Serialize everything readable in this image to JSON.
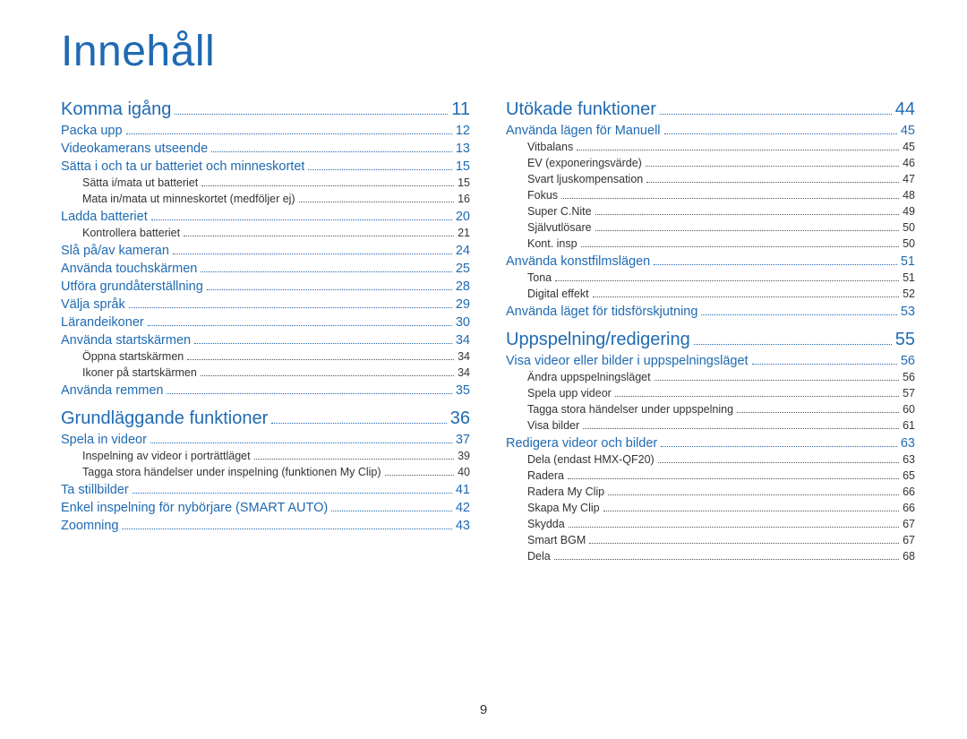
{
  "title": "Innehåll",
  "page_number": "9",
  "columns": [
    [
      {
        "level": 0,
        "label": "Komma igång",
        "page": "11"
      },
      {
        "level": 1,
        "label": "Packa upp",
        "page": "12"
      },
      {
        "level": 1,
        "label": "Videokamerans utseende",
        "page": "13"
      },
      {
        "level": 1,
        "label": "Sätta i och ta ur batteriet och minneskortet",
        "page": "15"
      },
      {
        "level": 2,
        "label": "Sätta i/mata ut batteriet",
        "page": "15"
      },
      {
        "level": 2,
        "label": "Mata in/mata ut minneskortet (medföljer ej)",
        "page": "16"
      },
      {
        "level": 1,
        "label": "Ladda batteriet",
        "page": "20"
      },
      {
        "level": 2,
        "label": "Kontrollera batteriet",
        "page": "21"
      },
      {
        "level": 1,
        "label": "Slå på/av kameran",
        "page": "24"
      },
      {
        "level": 1,
        "label": "Använda touchskärmen",
        "page": "25"
      },
      {
        "level": 1,
        "label": "Utföra grundåterställning",
        "page": "28"
      },
      {
        "level": 1,
        "label": "Välja språk",
        "page": "29"
      },
      {
        "level": 1,
        "label": "Lärandeikoner",
        "page": "30"
      },
      {
        "level": 1,
        "label": "Använda startskärmen",
        "page": "34"
      },
      {
        "level": 2,
        "label": "Öppna startskärmen",
        "page": "34"
      },
      {
        "level": 2,
        "label": "Ikoner på startskärmen",
        "page": "34"
      },
      {
        "level": 1,
        "label": "Använda remmen",
        "page": "35"
      },
      {
        "level": 0,
        "label": "Grundläggande funktioner",
        "page": "36"
      },
      {
        "level": 1,
        "label": "Spela in videor",
        "page": "37"
      },
      {
        "level": 2,
        "label": "Inspelning av videor i porträttläget",
        "page": "39"
      },
      {
        "level": 2,
        "label": "Tagga stora händelser under inspelning (funktionen My Clip)",
        "page": "40"
      },
      {
        "level": 1,
        "label": "Ta stillbilder",
        "page": "41"
      },
      {
        "level": 1,
        "label": "Enkel inspelning för nybörjare (SMART AUTO)",
        "page": "42"
      },
      {
        "level": 1,
        "label": "Zoomning",
        "page": "43"
      }
    ],
    [
      {
        "level": 0,
        "label": "Utökade funktioner",
        "page": "44"
      },
      {
        "level": 1,
        "label": "Använda lägen för Manuell",
        "page": "45"
      },
      {
        "level": 2,
        "label": "Vitbalans",
        "page": "45"
      },
      {
        "level": 2,
        "label": "EV (exponeringsvärde)",
        "page": "46"
      },
      {
        "level": 2,
        "label": "Svart ljuskompensation",
        "page": "47"
      },
      {
        "level": 2,
        "label": "Fokus",
        "page": "48"
      },
      {
        "level": 2,
        "label": "Super C.Nite",
        "page": "49"
      },
      {
        "level": 2,
        "label": "Självutlösare",
        "page": "50"
      },
      {
        "level": 2,
        "label": "Kont. insp",
        "page": "50"
      },
      {
        "level": 1,
        "label": "Använda konstfilmslägen",
        "page": "51"
      },
      {
        "level": 2,
        "label": "Tona",
        "page": "51"
      },
      {
        "level": 2,
        "label": "Digital effekt",
        "page": "52"
      },
      {
        "level": 1,
        "label": "Använda läget för tidsförskjutning",
        "page": "53"
      },
      {
        "level": 0,
        "label": "Uppspelning/redigering",
        "page": "55"
      },
      {
        "level": 1,
        "label": "Visa videor eller bilder i uppspelningsläget",
        "page": "56"
      },
      {
        "level": 2,
        "label": "Ändra uppspelningsläget",
        "page": "56"
      },
      {
        "level": 2,
        "label": "Spela upp videor",
        "page": "57"
      },
      {
        "level": 2,
        "label": "Tagga stora händelser under uppspelning",
        "page": "60"
      },
      {
        "level": 2,
        "label": "Visa bilder",
        "page": "61"
      },
      {
        "level": 1,
        "label": "Redigera videor och bilder",
        "page": "63"
      },
      {
        "level": 2,
        "label": "Dela (endast HMX-QF20)",
        "page": "63"
      },
      {
        "level": 2,
        "label": "Radera",
        "page": "65"
      },
      {
        "level": 2,
        "label": "Radera My Clip",
        "page": "66"
      },
      {
        "level": 2,
        "label": "Skapa My Clip",
        "page": "66"
      },
      {
        "level": 2,
        "label": "Skydda",
        "page": "67"
      },
      {
        "level": 2,
        "label": "Smart BGM",
        "page": "67"
      },
      {
        "level": 2,
        "label": "Dela",
        "page": "68"
      }
    ]
  ]
}
